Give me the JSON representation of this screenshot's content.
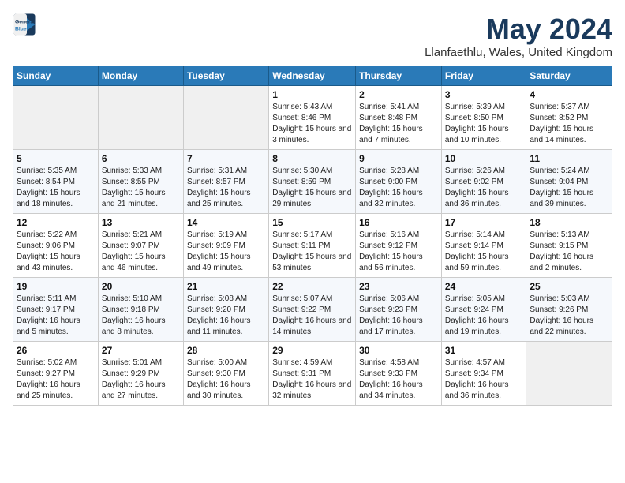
{
  "logo": {
    "line1": "General",
    "line2": "Blue"
  },
  "title": "May 2024",
  "location": "Llanfaethlu, Wales, United Kingdom",
  "days_of_week": [
    "Sunday",
    "Monday",
    "Tuesday",
    "Wednesday",
    "Thursday",
    "Friday",
    "Saturday"
  ],
  "weeks": [
    [
      {
        "day": "",
        "detail": ""
      },
      {
        "day": "",
        "detail": ""
      },
      {
        "day": "",
        "detail": ""
      },
      {
        "day": "1",
        "detail": "Sunrise: 5:43 AM\nSunset: 8:46 PM\nDaylight: 15 hours and 3 minutes."
      },
      {
        "day": "2",
        "detail": "Sunrise: 5:41 AM\nSunset: 8:48 PM\nDaylight: 15 hours and 7 minutes."
      },
      {
        "day": "3",
        "detail": "Sunrise: 5:39 AM\nSunset: 8:50 PM\nDaylight: 15 hours and 10 minutes."
      },
      {
        "day": "4",
        "detail": "Sunrise: 5:37 AM\nSunset: 8:52 PM\nDaylight: 15 hours and 14 minutes."
      }
    ],
    [
      {
        "day": "5",
        "detail": "Sunrise: 5:35 AM\nSunset: 8:54 PM\nDaylight: 15 hours and 18 minutes."
      },
      {
        "day": "6",
        "detail": "Sunrise: 5:33 AM\nSunset: 8:55 PM\nDaylight: 15 hours and 21 minutes."
      },
      {
        "day": "7",
        "detail": "Sunrise: 5:31 AM\nSunset: 8:57 PM\nDaylight: 15 hours and 25 minutes."
      },
      {
        "day": "8",
        "detail": "Sunrise: 5:30 AM\nSunset: 8:59 PM\nDaylight: 15 hours and 29 minutes."
      },
      {
        "day": "9",
        "detail": "Sunrise: 5:28 AM\nSunset: 9:00 PM\nDaylight: 15 hours and 32 minutes."
      },
      {
        "day": "10",
        "detail": "Sunrise: 5:26 AM\nSunset: 9:02 PM\nDaylight: 15 hours and 36 minutes."
      },
      {
        "day": "11",
        "detail": "Sunrise: 5:24 AM\nSunset: 9:04 PM\nDaylight: 15 hours and 39 minutes."
      }
    ],
    [
      {
        "day": "12",
        "detail": "Sunrise: 5:22 AM\nSunset: 9:06 PM\nDaylight: 15 hours and 43 minutes."
      },
      {
        "day": "13",
        "detail": "Sunrise: 5:21 AM\nSunset: 9:07 PM\nDaylight: 15 hours and 46 minutes."
      },
      {
        "day": "14",
        "detail": "Sunrise: 5:19 AM\nSunset: 9:09 PM\nDaylight: 15 hours and 49 minutes."
      },
      {
        "day": "15",
        "detail": "Sunrise: 5:17 AM\nSunset: 9:11 PM\nDaylight: 15 hours and 53 minutes."
      },
      {
        "day": "16",
        "detail": "Sunrise: 5:16 AM\nSunset: 9:12 PM\nDaylight: 15 hours and 56 minutes."
      },
      {
        "day": "17",
        "detail": "Sunrise: 5:14 AM\nSunset: 9:14 PM\nDaylight: 15 hours and 59 minutes."
      },
      {
        "day": "18",
        "detail": "Sunrise: 5:13 AM\nSunset: 9:15 PM\nDaylight: 16 hours and 2 minutes."
      }
    ],
    [
      {
        "day": "19",
        "detail": "Sunrise: 5:11 AM\nSunset: 9:17 PM\nDaylight: 16 hours and 5 minutes."
      },
      {
        "day": "20",
        "detail": "Sunrise: 5:10 AM\nSunset: 9:18 PM\nDaylight: 16 hours and 8 minutes."
      },
      {
        "day": "21",
        "detail": "Sunrise: 5:08 AM\nSunset: 9:20 PM\nDaylight: 16 hours and 11 minutes."
      },
      {
        "day": "22",
        "detail": "Sunrise: 5:07 AM\nSunset: 9:22 PM\nDaylight: 16 hours and 14 minutes."
      },
      {
        "day": "23",
        "detail": "Sunrise: 5:06 AM\nSunset: 9:23 PM\nDaylight: 16 hours and 17 minutes."
      },
      {
        "day": "24",
        "detail": "Sunrise: 5:05 AM\nSunset: 9:24 PM\nDaylight: 16 hours and 19 minutes."
      },
      {
        "day": "25",
        "detail": "Sunrise: 5:03 AM\nSunset: 9:26 PM\nDaylight: 16 hours and 22 minutes."
      }
    ],
    [
      {
        "day": "26",
        "detail": "Sunrise: 5:02 AM\nSunset: 9:27 PM\nDaylight: 16 hours and 25 minutes."
      },
      {
        "day": "27",
        "detail": "Sunrise: 5:01 AM\nSunset: 9:29 PM\nDaylight: 16 hours and 27 minutes."
      },
      {
        "day": "28",
        "detail": "Sunrise: 5:00 AM\nSunset: 9:30 PM\nDaylight: 16 hours and 30 minutes."
      },
      {
        "day": "29",
        "detail": "Sunrise: 4:59 AM\nSunset: 9:31 PM\nDaylight: 16 hours and 32 minutes."
      },
      {
        "day": "30",
        "detail": "Sunrise: 4:58 AM\nSunset: 9:33 PM\nDaylight: 16 hours and 34 minutes."
      },
      {
        "day": "31",
        "detail": "Sunrise: 4:57 AM\nSunset: 9:34 PM\nDaylight: 16 hours and 36 minutes."
      },
      {
        "day": "",
        "detail": ""
      }
    ]
  ]
}
